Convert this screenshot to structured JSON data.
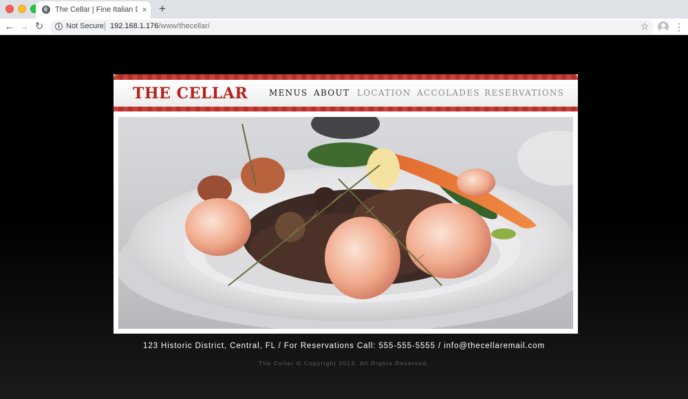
{
  "browser": {
    "tab_title": "The Cellar | Fine Italian Dining",
    "tab_close": "×",
    "new_tab": "+",
    "back_icon": "←",
    "forward_icon": "→",
    "reload_icon": "↻",
    "security_label": "Not Secure",
    "url_host": "192.168.1.176",
    "url_path": "/www/thecellar/",
    "star_icon": "☆",
    "menu_icon": "⋮"
  },
  "site": {
    "logo": "THE CELLAR",
    "nav": [
      {
        "label": "MENUS",
        "state": "active"
      },
      {
        "label": "ABOUT",
        "state": "active"
      },
      {
        "label": "LOCATION",
        "state": "inactive"
      },
      {
        "label": "ACCOLADES",
        "state": "inactive"
      },
      {
        "label": "RESERVATIONS",
        "state": "inactive"
      }
    ],
    "hero_image": "plated-shrimp-dish",
    "footer_contact": "123 Historic District, Central, FL  /  For Reservations Call: 555-555-5555  /  info@thecellaremail.com",
    "copyright": "The Cellar © Copyright 2013. All Rights Reserved."
  },
  "colors": {
    "brand_red": "#b2241c",
    "stripe_red": "#c8423a",
    "page_background": "#000000"
  }
}
